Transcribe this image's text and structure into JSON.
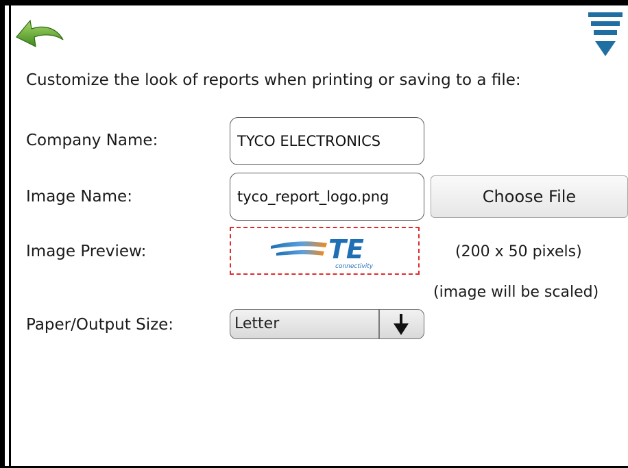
{
  "intro": "Customize the look of reports when printing or saving to a file:",
  "company": {
    "label": "Company Name:",
    "value": "TYCO ELECTRONICS"
  },
  "image": {
    "label": "Image Name:",
    "value": "tyco_report_logo.png",
    "choose_label": "Choose File"
  },
  "preview": {
    "label": "Image Preview:",
    "size_note": "(200 x 50 pixels)",
    "scale_note": "(image will be scaled)",
    "logo_letters": "TE",
    "logo_caption": "connectivity"
  },
  "paper": {
    "label": "Paper/Output Size:",
    "selected": "Letter"
  },
  "colors": {
    "back_icon": "#5f9f2c",
    "menu_icon": "#1f6fa3",
    "logo_blue": "#1f6fb5",
    "logo_orange": "#f08a1c",
    "preview_border": "#e02a2a"
  },
  "icons": {
    "back": "back-arrow-icon",
    "menu": "menu-icon",
    "dropdown": "dropdown-arrow-icon"
  }
}
